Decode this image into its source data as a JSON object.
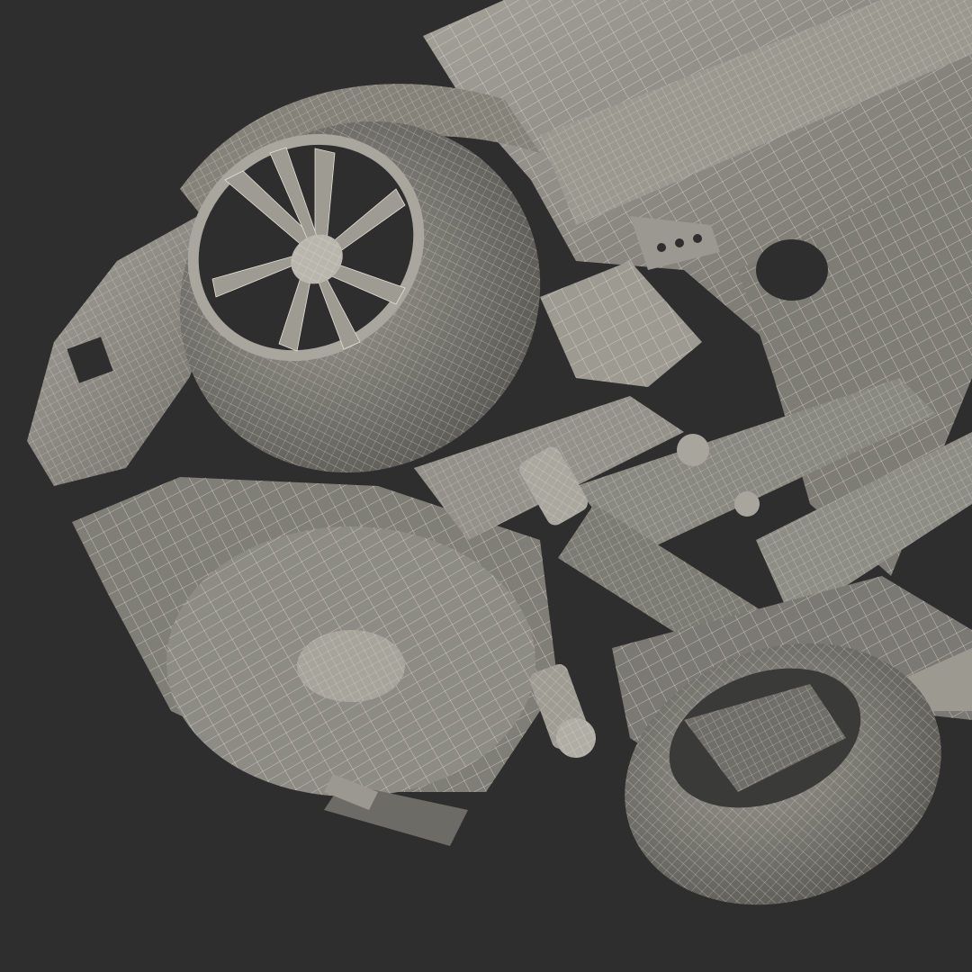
{
  "scene": {
    "background_color": "#2e2e2e",
    "mesh_fill_color": "#8b8a83",
    "mesh_shade_color": "#6b6a64",
    "mesh_highlight_color": "#b4b2a8",
    "wire_color": "#e4e2d6",
    "subject": "car-chassis-wireframe"
  }
}
